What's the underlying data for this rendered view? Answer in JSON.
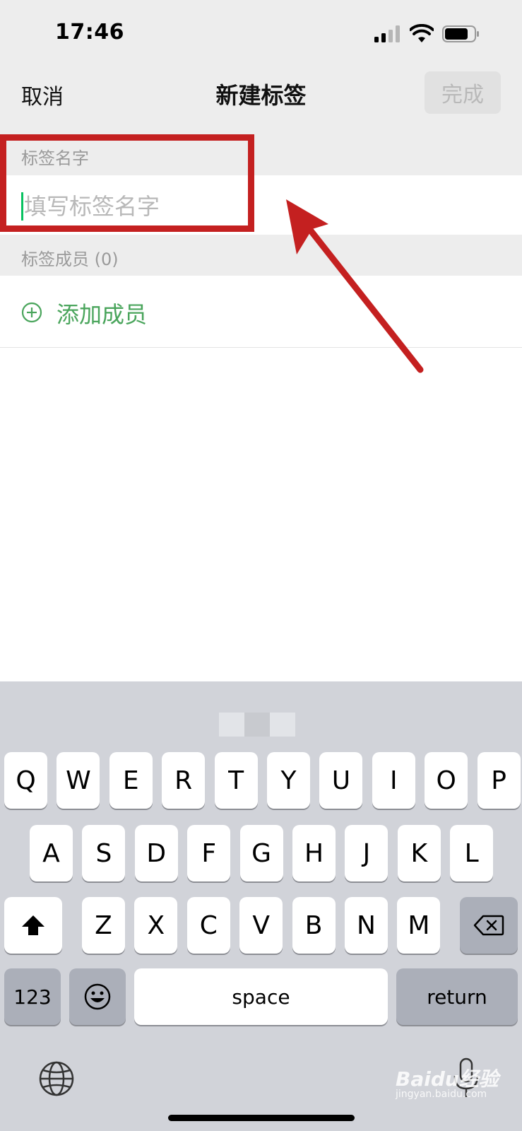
{
  "status_bar": {
    "time": "17:46"
  },
  "nav": {
    "cancel_label": "取消",
    "title": "新建标签",
    "done_label": "完成"
  },
  "tag_name_section": {
    "header": "标签名字",
    "input_placeholder": "填写标签名字",
    "input_value": ""
  },
  "members_section": {
    "header": "标签成员 (0)",
    "add_label": "添加成员"
  },
  "keyboard": {
    "row1": [
      "Q",
      "W",
      "E",
      "R",
      "T",
      "Y",
      "U",
      "I",
      "O",
      "P"
    ],
    "row2": [
      "A",
      "S",
      "D",
      "F",
      "G",
      "H",
      "J",
      "K",
      "L"
    ],
    "row3": [
      "Z",
      "X",
      "C",
      "V",
      "B",
      "N",
      "M"
    ],
    "numbers_label": "123",
    "space_label": "space",
    "return_label": "return"
  },
  "watermark": {
    "text": "Baidu经验",
    "sub": "jingyan.baidu.com"
  },
  "colors": {
    "accent": "#07c160",
    "add_text": "#4aa55c",
    "annotation": "#c42020",
    "background_gray": "#ededed",
    "keyboard_bg": "#d1d3d9"
  },
  "icons": {
    "signal": "cellular-signal-icon",
    "wifi": "wifi-icon",
    "battery": "battery-icon",
    "add": "plus-circle-icon",
    "shift": "shift-arrow-icon",
    "backspace": "backspace-icon",
    "emoji": "emoji-icon",
    "globe": "globe-icon",
    "mic": "microphone-icon"
  }
}
